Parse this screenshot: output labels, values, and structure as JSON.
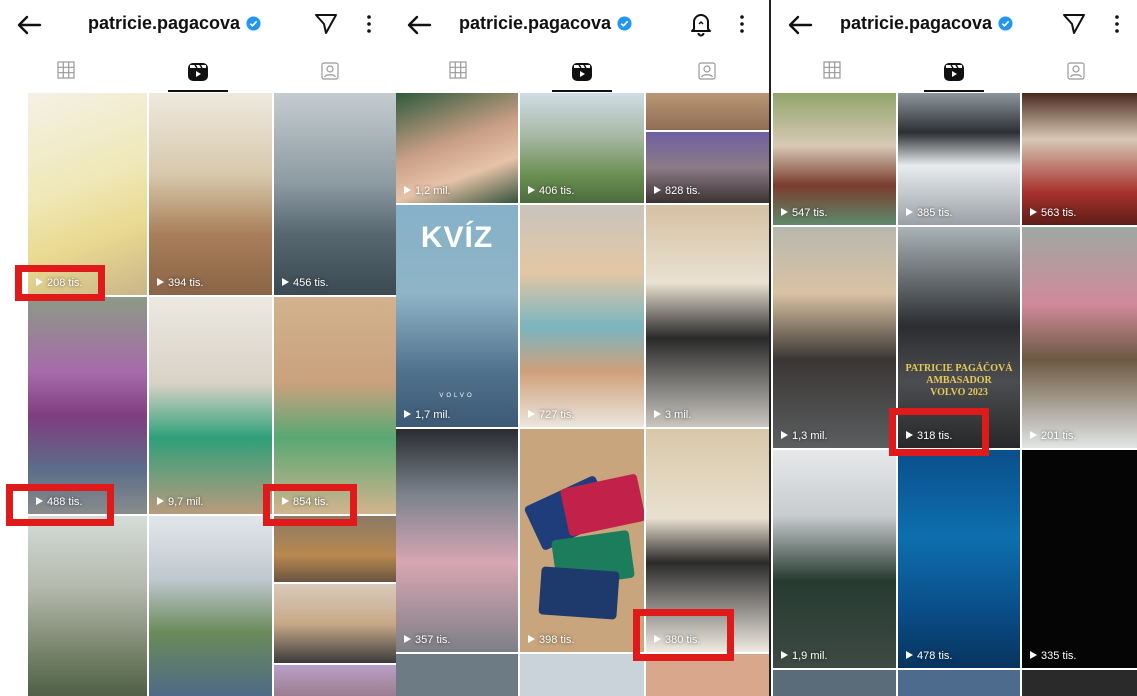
{
  "profile": {
    "username": "patricie.pagacova"
  },
  "colors": {
    "highlight": "#e0191b",
    "verified": "#2196f3",
    "text": "#111111"
  },
  "icons": {
    "back": "arrow-left-icon",
    "direct": "send-icon",
    "notify": "bell-icon",
    "more": "more-vertical-icon",
    "grid": "grid-icon",
    "reels": "reels-icon",
    "tagged": "tagged-icon",
    "play": "play-icon"
  },
  "panels": [
    {
      "header_action_icon": "send-icon",
      "tiles": [
        {
          "views": "208 tis.",
          "highlighted": true
        },
        {
          "views": "394 tis.",
          "highlighted": false
        },
        {
          "views": "456 tis.",
          "highlighted": false
        },
        {
          "views": "488 tis.",
          "highlighted": true
        },
        {
          "views": "9,7 mil.",
          "highlighted": false
        },
        {
          "views": "854 tis.",
          "highlighted": true
        },
        {
          "views": "",
          "highlighted": false
        },
        {
          "views": "",
          "highlighted": false
        },
        {
          "views": "",
          "highlighted": false
        },
        {
          "views": "",
          "highlighted": false
        },
        {
          "views": "",
          "highlighted": false
        }
      ]
    },
    {
      "header_action_icon": "bell-icon",
      "kviz_text": "KVÍZ",
      "kviz_logo": "VOLVO",
      "tiles": [
        {
          "views": "1,2 mil.",
          "highlighted": false
        },
        {
          "views": "406 tis.",
          "highlighted": false
        },
        {
          "views": "",
          "highlighted": false
        },
        {
          "views": "828 tis.",
          "highlighted": false
        },
        {
          "views": "1,7 mil.",
          "highlighted": false
        },
        {
          "views": "727 tis.",
          "highlighted": false
        },
        {
          "views": "3 mil.",
          "highlighted": false
        },
        {
          "views": "357 tis.",
          "highlighted": false
        },
        {
          "views": "398 tis.",
          "highlighted": false
        },
        {
          "views": "380 tis.",
          "highlighted": true
        }
      ]
    },
    {
      "header_action_icon": "send-icon",
      "ambassador_text": [
        "PATRICIE PAGÁČOVÁ",
        "AMBASADOR",
        "VOLVO 2023"
      ],
      "tiles": [
        {
          "views": "547 tis.",
          "highlighted": false
        },
        {
          "views": "385 tis.",
          "highlighted": false
        },
        {
          "views": "563 tis.",
          "highlighted": false
        },
        {
          "views": "1,3 mil.",
          "highlighted": false
        },
        {
          "views": "318 tis.",
          "highlighted": true
        },
        {
          "views": "201 tis.",
          "highlighted": false
        },
        {
          "views": "1,9 mil.",
          "highlighted": false
        },
        {
          "views": "478 tis.",
          "highlighted": false
        },
        {
          "views": "335 tis.",
          "highlighted": false
        }
      ]
    }
  ]
}
